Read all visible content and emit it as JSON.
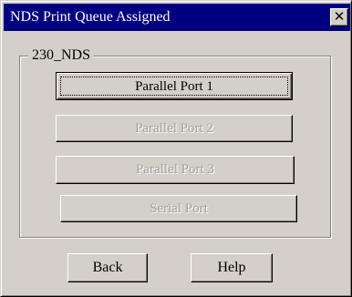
{
  "window": {
    "title": "NDS Print Queue Assigned",
    "close_symbol": "✕"
  },
  "group": {
    "label": "230_NDS"
  },
  "ports": [
    {
      "label": "Parallel Port 1",
      "enabled": true,
      "default": true
    },
    {
      "label": "Parallel Port 2",
      "enabled": false
    },
    {
      "label": "Parallel Port 3",
      "enabled": false
    },
    {
      "label": "Serial Port",
      "enabled": false
    }
  ],
  "actions": {
    "back_label": "Back",
    "help_label": "Help"
  }
}
